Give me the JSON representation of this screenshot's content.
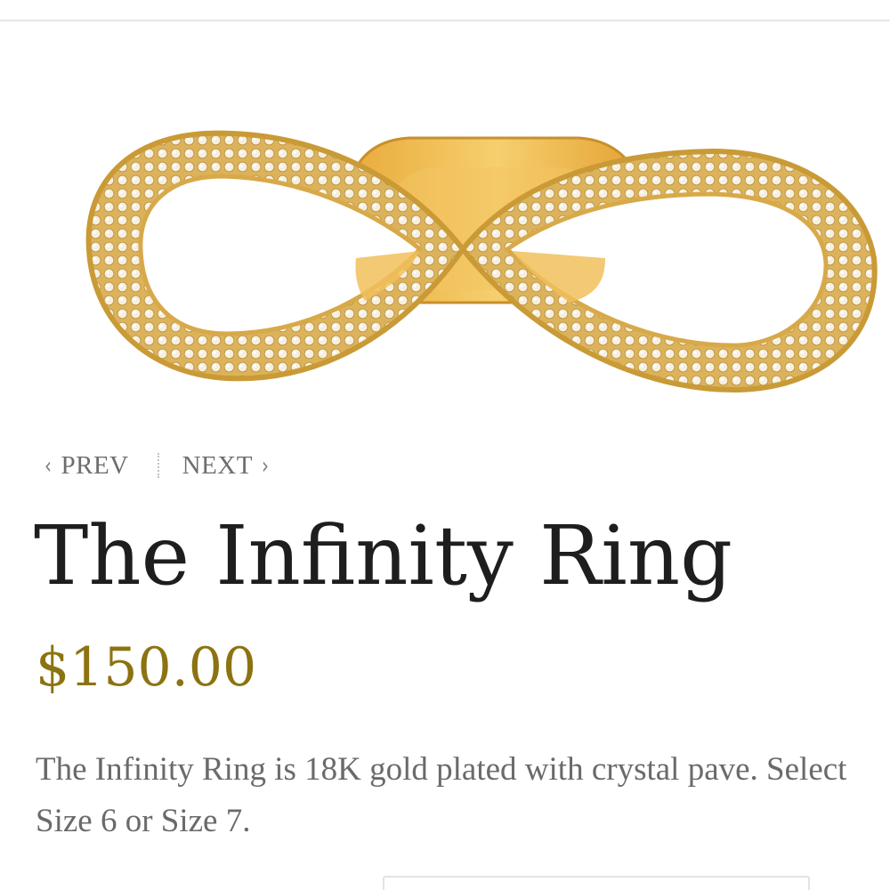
{
  "pager": {
    "prev_label": "PREV",
    "next_label": "NEXT"
  },
  "product": {
    "title": "The Infinity Ring",
    "price": "$150.00",
    "description": "The Infinity Ring is 18K gold plated with crystal pave. Select Size 6 or Size 7.",
    "image_alt": "Gold infinity ring with crystal pave"
  },
  "icons": {
    "prev": "chevron-left-icon",
    "next": "chevron-right-icon"
  },
  "colors": {
    "price": "#8c7311",
    "gold": "#d9ad4a",
    "title": "#1e1e1e",
    "body_text": "#6a6a6a"
  }
}
